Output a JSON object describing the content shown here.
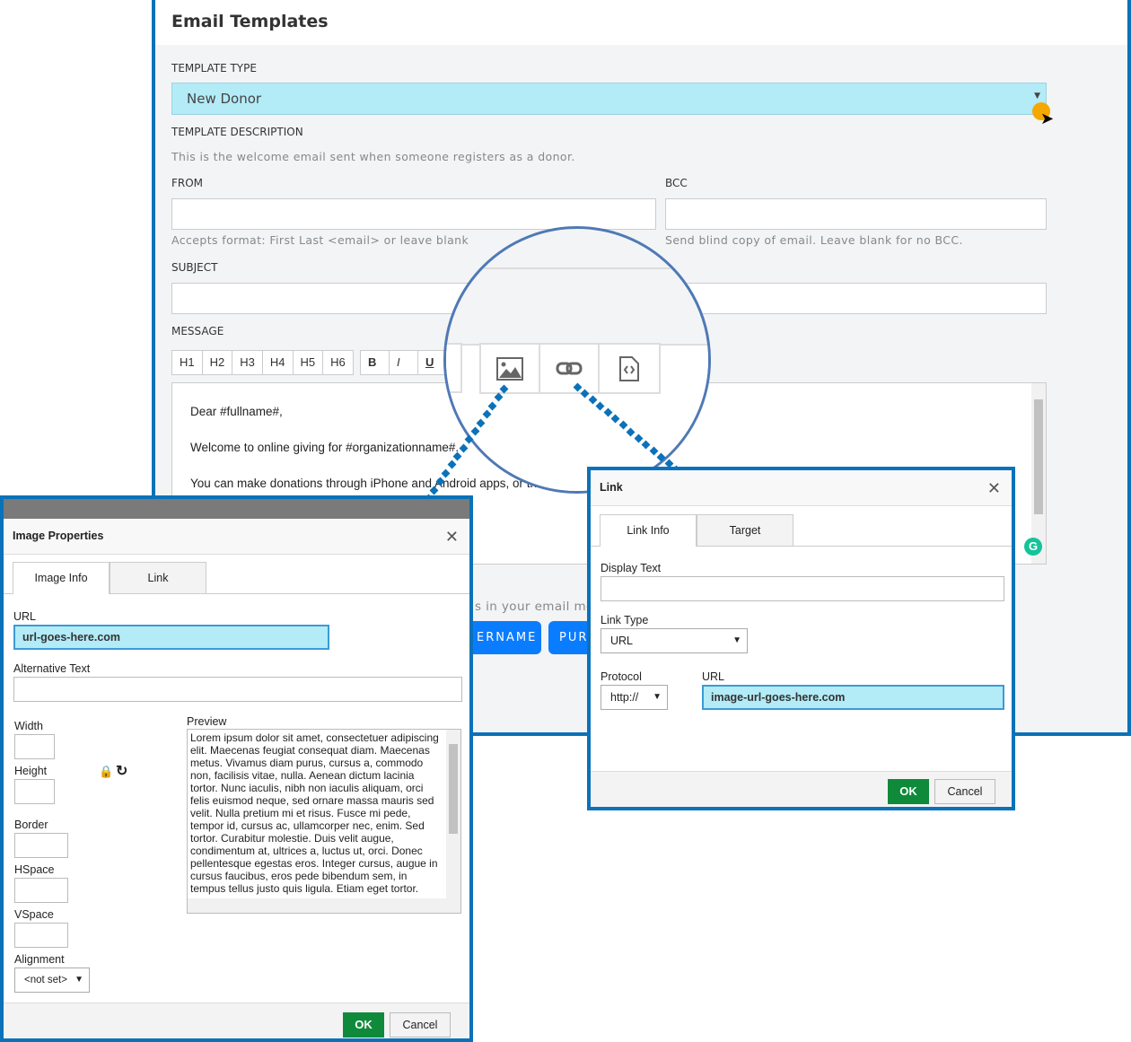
{
  "main": {
    "title": "Email Templates",
    "template_type_label": "TEMPLATE TYPE",
    "template_type_value": "New Donor",
    "template_description_label": "TEMPLATE DESCRIPTION",
    "template_description": "This is the welcome email sent when someone registers as a donor.",
    "from_label": "FROM",
    "from_help": "Accepts format: First Last <email> or leave blank",
    "bcc_label": "BCC",
    "bcc_help": "Send blind copy of email. Leave blank for no BCC.",
    "subject_label": "SUBJECT",
    "message_label": "MESSAGE",
    "toolbar": {
      "headings": [
        "H1",
        "H2",
        "H3",
        "H4",
        "H5",
        "H6"
      ],
      "bold": "B",
      "italic": "I",
      "underline": "U"
    },
    "message_lines": [
      "Dear #fullname#,",
      "Welcome to online giving for #organizationname#.",
      "You can make donations through iPhone and Android apps, or th"
    ],
    "tags_help": "s in your email me",
    "tag_buttons": [
      "ERNAME",
      "PURL"
    ]
  },
  "image_dialog": {
    "title": "Image Properties",
    "tabs": [
      "Image Info",
      "Link"
    ],
    "url_label": "URL",
    "url_value": "url-goes-here.com",
    "alt_label": "Alternative Text",
    "width_label": "Width",
    "height_label": "Height",
    "border_label": "Border",
    "hspace_label": "HSpace",
    "vspace_label": "VSpace",
    "alignment_label": "Alignment",
    "alignment_value": "<not set>",
    "preview_label": "Preview",
    "preview_text": "Lorem ipsum dolor sit amet, consectetuer adipiscing elit. Maecenas feugiat consequat diam. Maecenas metus. Vivamus diam purus, cursus a, commodo non, facilisis vitae, nulla. Aenean dictum lacinia tortor. Nunc iaculis, nibh non iaculis aliquam, orci felis euismod neque, sed ornare massa mauris sed velit. Nulla pretium mi et risus. Fusce mi pede, tempor id, cursus ac, ullamcorper nec, enim. Sed tortor. Curabitur molestie. Duis velit augue, condimentum at, ultrices a, luctus ut, orci. Donec pellentesque egestas eros. Integer cursus, augue in cursus faucibus, eros pede bibendum sem, in tempus tellus justo quis ligula. Etiam eget tortor.",
    "ok": "OK",
    "cancel": "Cancel"
  },
  "link_dialog": {
    "title": "Link",
    "tabs": [
      "Link Info",
      "Target"
    ],
    "display_text_label": "Display Text",
    "link_type_label": "Link Type",
    "link_type_value": "URL",
    "protocol_label": "Protocol",
    "protocol_value": "http://",
    "url_label": "URL",
    "url_value": "image-url-goes-here.com",
    "ok": "OK",
    "cancel": "Cancel"
  },
  "colors": {
    "accent": "#0b72b9",
    "select_bg": "#b3ebf7",
    "ok": "#0f8a3a",
    "tag_button": "#0a7cff"
  }
}
